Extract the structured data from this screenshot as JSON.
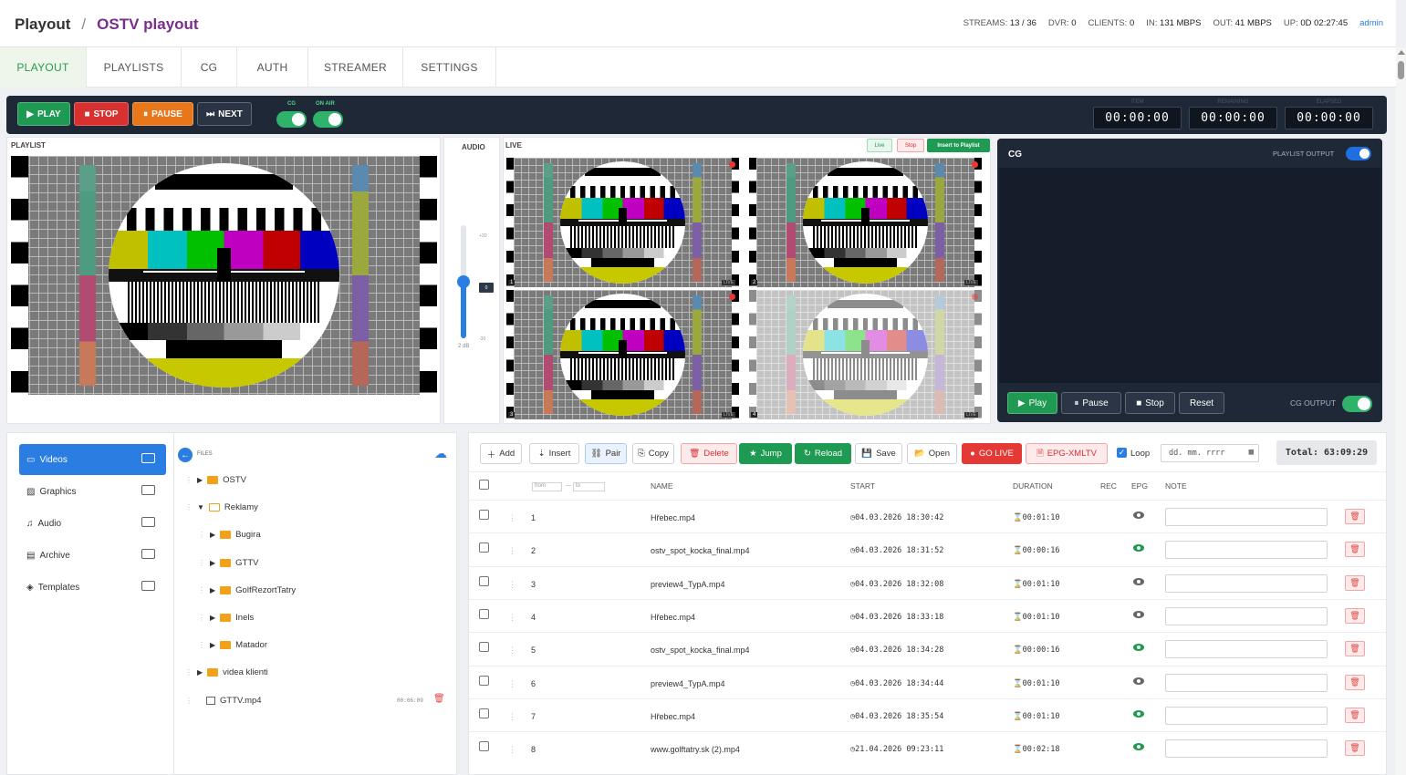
{
  "breadcrumb": {
    "root": "Playout",
    "separator": "/",
    "current": "OSTV playout"
  },
  "stats": {
    "streams_label": "STREAMS:",
    "streams_value": "13 / 36",
    "dvr_label": "DVR:",
    "dvr_value": "0",
    "clients_label": "CLIENTS:",
    "clients_value": "0",
    "in_label": "IN:",
    "in_value": "131 MBPS",
    "out_label": "OUT:",
    "out_value": "41 MBPS",
    "up_label": "UP:",
    "up_value": "0D 02:27:45",
    "user": "admin"
  },
  "nav": {
    "tabs": [
      "PLAYOUT",
      "PLAYLISTS",
      "CG",
      "AUTH",
      "STREAMER",
      "SETTINGS"
    ]
  },
  "controls": {
    "play": "PLAY",
    "stop": "STOP",
    "pause": "PAUSE",
    "next": "NEXT",
    "cg_label": "CG",
    "onair_label": "ON AIR"
  },
  "timers": {
    "item_label": "ITEM",
    "remaining_label": "REMAINING",
    "elapsed_label": "ELAPSED",
    "item": "00:00:00",
    "remaining": "00:00:00",
    "elapsed": "00:00:00"
  },
  "playlist_label": "PLAYLIST",
  "audio": {
    "label": "AUDIO",
    "plus": "+30",
    "minus": "-30",
    "value": "2 dB",
    "badge": "0",
    "level": 0.5
  },
  "live": {
    "label": "LIVE",
    "live_btn": "Live",
    "stop_btn": "Stop",
    "insert_btn": "Insert to Playlist",
    "tiles": [
      "1",
      "2",
      "3",
      "4"
    ],
    "tile_badge": "LIVE"
  },
  "cg": {
    "title": "CG",
    "playlist_output": "PLAYLIST OUTPUT",
    "play": "Play",
    "pause": "Pause",
    "stop": "Stop",
    "reset": "Reset",
    "cg_output": "CG OUTPUT"
  },
  "library": {
    "categories": [
      "Videos",
      "Graphics",
      "Audio",
      "Archive",
      "Templates"
    ],
    "files_label": "FILES",
    "tree": [
      {
        "name": "OSTV",
        "level": 0
      },
      {
        "name": "Reklamy",
        "level": 0
      },
      {
        "name": "Bugira",
        "level": 1
      },
      {
        "name": "GTTV",
        "level": 1
      },
      {
        "name": "GolfRezortTatry",
        "level": 1
      },
      {
        "name": "Inels",
        "level": 1
      },
      {
        "name": "Matador",
        "level": 1
      },
      {
        "name": "videa klienti",
        "level": 0
      }
    ],
    "file": {
      "name": "GTTV.mp4",
      "duration": "00:06:09"
    }
  },
  "toolbar": {
    "add": "Add",
    "insert": "Insert",
    "pair": "Pair",
    "copy": "Copy",
    "delete": "Delete",
    "jump": "Jump",
    "reload": "Reload",
    "save": "Save",
    "open": "Open",
    "golive": "GO LIVE",
    "epg": "EPG-XMLTV",
    "loop": "Loop",
    "date_placeholder": "dd. mm. rrrr",
    "total": "Total: 63:09:29"
  },
  "table": {
    "headers": {
      "from": "from",
      "to": "to",
      "name": "NAME",
      "start": "START",
      "duration": "DURATION",
      "rec": "REC",
      "epg": "EPG",
      "note": "NOTE"
    },
    "rows": [
      {
        "n": "1",
        "name": "Hřebec.mp4",
        "start": "04.03.2026 18:30:42",
        "dur": "00:01:10",
        "epg": "gray"
      },
      {
        "n": "2",
        "name": "ostv_spot_kocka_final.mp4",
        "start": "04.03.2026 18:31:52",
        "dur": "00:00:16",
        "epg": "green"
      },
      {
        "n": "3",
        "name": "preview4_TypA.mp4",
        "start": "04.03.2026 18:32:08",
        "dur": "00:01:10",
        "epg": "gray"
      },
      {
        "n": "4",
        "name": "Hřebec.mp4",
        "start": "04.03.2026 18:33:18",
        "dur": "00:01:10",
        "epg": "gray"
      },
      {
        "n": "5",
        "name": "ostv_spot_kocka_final.mp4",
        "start": "04.03.2026 18:34:28",
        "dur": "00:00:16",
        "epg": "green"
      },
      {
        "n": "6",
        "name": "preview4_TypA.mp4",
        "start": "04.03.2026 18:34:44",
        "dur": "00:01:10",
        "epg": "gray"
      },
      {
        "n": "7",
        "name": "Hřebec.mp4",
        "start": "04.03.2026 18:35:54",
        "dur": "00:01:10",
        "epg": "green"
      },
      {
        "n": "8",
        "name": "www.golftatry.sk (2).mp4",
        "start": "21.04.2026 09:23:11",
        "dur": "00:02:18",
        "epg": "green"
      }
    ]
  },
  "colors": {
    "accent": "#2a7de1",
    "brand": "#7b2d8e",
    "play": "#1e9a52",
    "stop": "#d93030",
    "pause": "#e8761a",
    "epg_green": "#1f9a50"
  }
}
